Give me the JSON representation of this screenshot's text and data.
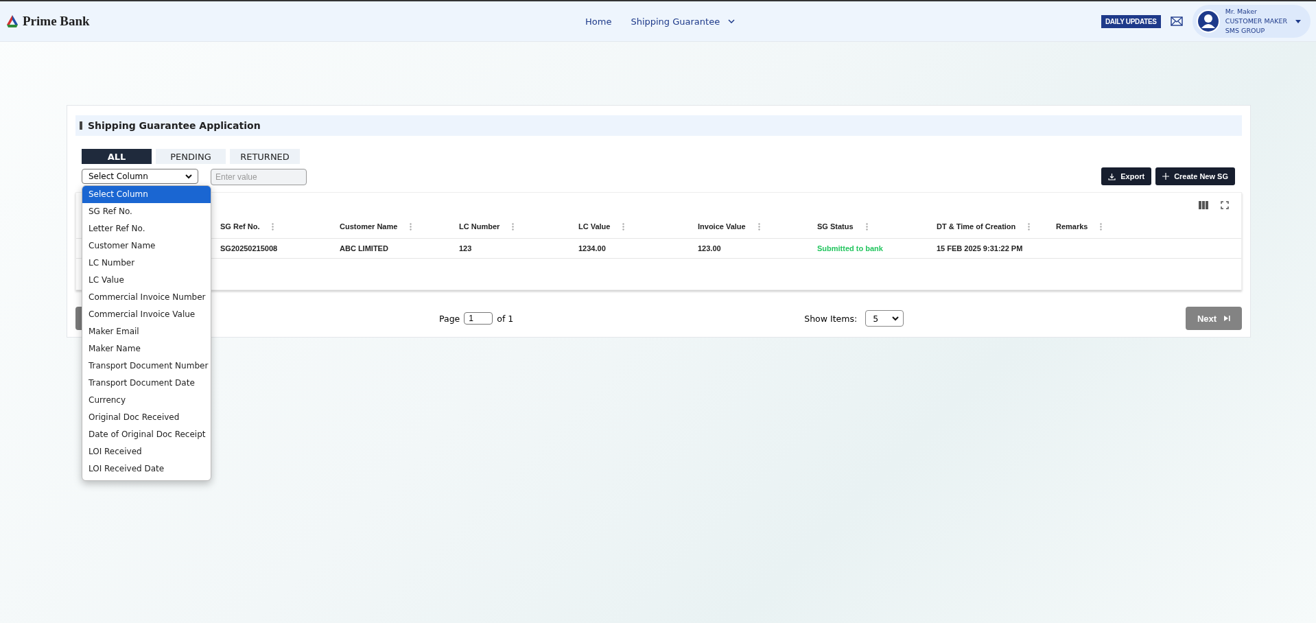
{
  "header": {
    "brand": "Prime Bank",
    "nav": [
      {
        "label": "Home",
        "has_menu": false
      },
      {
        "label": "Shipping Guarantee",
        "has_menu": true
      }
    ],
    "daily_updates": "DAILY UPDATES",
    "user": {
      "name": "Mr. Maker",
      "role": "CUSTOMER MAKER",
      "group": "SMS GROUP"
    }
  },
  "card": {
    "title": "Shipping Guarantee Application",
    "tabs": [
      {
        "label": "ALL",
        "selected": true
      },
      {
        "label": "PENDING",
        "selected": false
      },
      {
        "label": "RETURNED",
        "selected": false
      }
    ],
    "filter": {
      "value": "Select Column",
      "placeholder": "Enter value",
      "options": [
        {
          "label": "Select Column",
          "selected": true
        },
        {
          "label": "SG Ref No.",
          "selected": false
        },
        {
          "label": "Letter Ref No.",
          "selected": false
        },
        {
          "label": "Customer Name",
          "selected": false
        },
        {
          "label": "LC Number",
          "selected": false
        },
        {
          "label": "LC Value",
          "selected": false
        },
        {
          "label": "Commercial Invoice Number",
          "selected": false
        },
        {
          "label": "Commercial Invoice Value",
          "selected": false
        },
        {
          "label": "Maker Email",
          "selected": false
        },
        {
          "label": "Maker Name",
          "selected": false
        },
        {
          "label": "Transport Document Number",
          "selected": false
        },
        {
          "label": "Transport Document Date",
          "selected": false
        },
        {
          "label": "Currency",
          "selected": false
        },
        {
          "label": "Original Doc Received",
          "selected": false
        },
        {
          "label": "Date of Original Doc Receipt",
          "selected": false
        },
        {
          "label": "LOI Received",
          "selected": false
        },
        {
          "label": "LOI Received Date",
          "selected": false
        }
      ]
    },
    "actions": [
      {
        "label": "Export",
        "kind": "export"
      },
      {
        "label": "Create New SG",
        "kind": "create"
      }
    ],
    "table": {
      "columns": [
        "SG Ref No.",
        "Customer Name",
        "LC Number",
        "LC Value",
        "Invoice Value",
        "SG Status",
        "DT & Time of Creation",
        "Remarks"
      ],
      "rows": [
        [
          {
            "text": "SG20250215008",
            "kind": "text"
          },
          {
            "text": "ABC LIMITED",
            "kind": "text"
          },
          {
            "text": "123",
            "kind": "text"
          },
          {
            "text": "1234.00",
            "kind": "text"
          },
          {
            "text": "123.00",
            "kind": "text"
          },
          {
            "text": "Submitted to bank",
            "kind": "status"
          },
          {
            "text": "15 FEB 2025 9:31:22 PM",
            "kind": "text"
          }
        ]
      ]
    },
    "pagination": {
      "previous_disabled": true,
      "page_label": "Page",
      "page": "1",
      "of": "of 1",
      "show_label": "Show Items:",
      "show_value": "5",
      "next": "Next",
      "next_disabled": true
    }
  }
}
